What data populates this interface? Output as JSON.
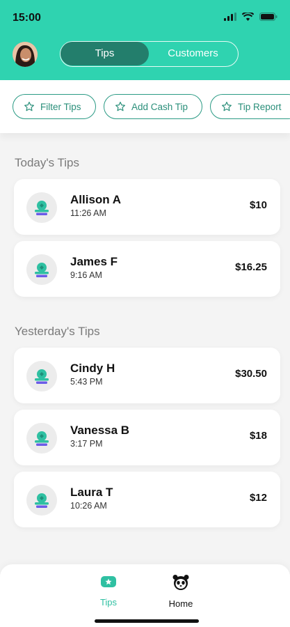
{
  "status_bar": {
    "time": "15:00",
    "icons": [
      "cellular-signal-icon",
      "wifi-icon",
      "battery-icon"
    ]
  },
  "header": {
    "avatar": "user-avatar",
    "tabs": [
      {
        "label": "Tips",
        "active": true
      },
      {
        "label": "Customers",
        "active": false
      }
    ]
  },
  "actions": [
    {
      "label": "Filter Tips",
      "icon": "star-outline-icon"
    },
    {
      "label": "Add Cash Tip",
      "icon": "star-outline-icon"
    },
    {
      "label": "Tip Report",
      "icon": "star-outline-icon"
    }
  ],
  "sections": [
    {
      "title": "Today's Tips",
      "items": [
        {
          "name": "Allison A",
          "time": "11:26 AM",
          "amount": "$10"
        },
        {
          "name": "James F",
          "time": "9:16 AM",
          "amount": "$16.25"
        }
      ]
    },
    {
      "title": "Yesterday's Tips",
      "items": [
        {
          "name": "Cindy H",
          "time": "5:43 PM",
          "amount": "$30.50"
        },
        {
          "name": "Vanessa B",
          "time": "3:17 PM",
          "amount": "$18"
        },
        {
          "name": "Laura T",
          "time": "10:26 AM",
          "amount": "$12"
        }
      ]
    }
  ],
  "tab_bar": {
    "items": [
      {
        "label": "Tips",
        "icon": "tips-icon",
        "active": true
      },
      {
        "label": "Home",
        "icon": "panda-icon",
        "active": false
      }
    ]
  },
  "colors": {
    "brand": "#2fd3b0",
    "brand_dark": "#237e6c",
    "chip_border": "#2a9a84",
    "active_tab": "#2fc0a2"
  }
}
